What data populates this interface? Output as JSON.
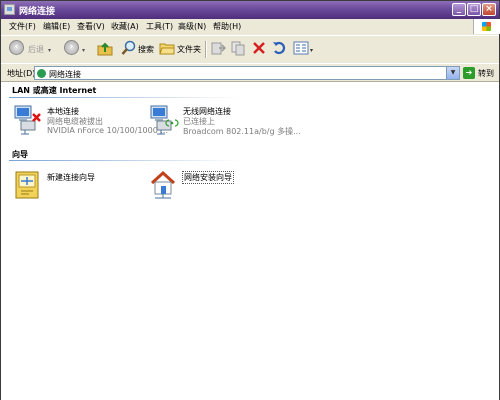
{
  "window": {
    "title": "网络连接"
  },
  "menu": {
    "items": [
      "文件(F)",
      "编辑(E)",
      "查看(V)",
      "收藏(A)",
      "工具(T)",
      "高级(N)",
      "帮助(H)"
    ]
  },
  "toolbar": {
    "back_label": "后退",
    "search_label": "搜索",
    "folders_label": "文件夹"
  },
  "address": {
    "label": "地址(D)",
    "value": "网络连接",
    "go_label": "转到"
  },
  "groups": [
    {
      "title": "LAN 或高速 Internet",
      "items": [
        {
          "name": "本地连接",
          "status": "网络电缆被拔出",
          "device": "NVIDIA nForce 10/100/1000 ..."
        },
        {
          "name": "无线网络连接",
          "status": "已连接上",
          "device": "Broadcom 802.11a/b/g 多操..."
        }
      ]
    },
    {
      "title": "向导",
      "items": [
        {
          "name": "新建连接向导"
        },
        {
          "name": "网络安装向导"
        }
      ]
    }
  ]
}
